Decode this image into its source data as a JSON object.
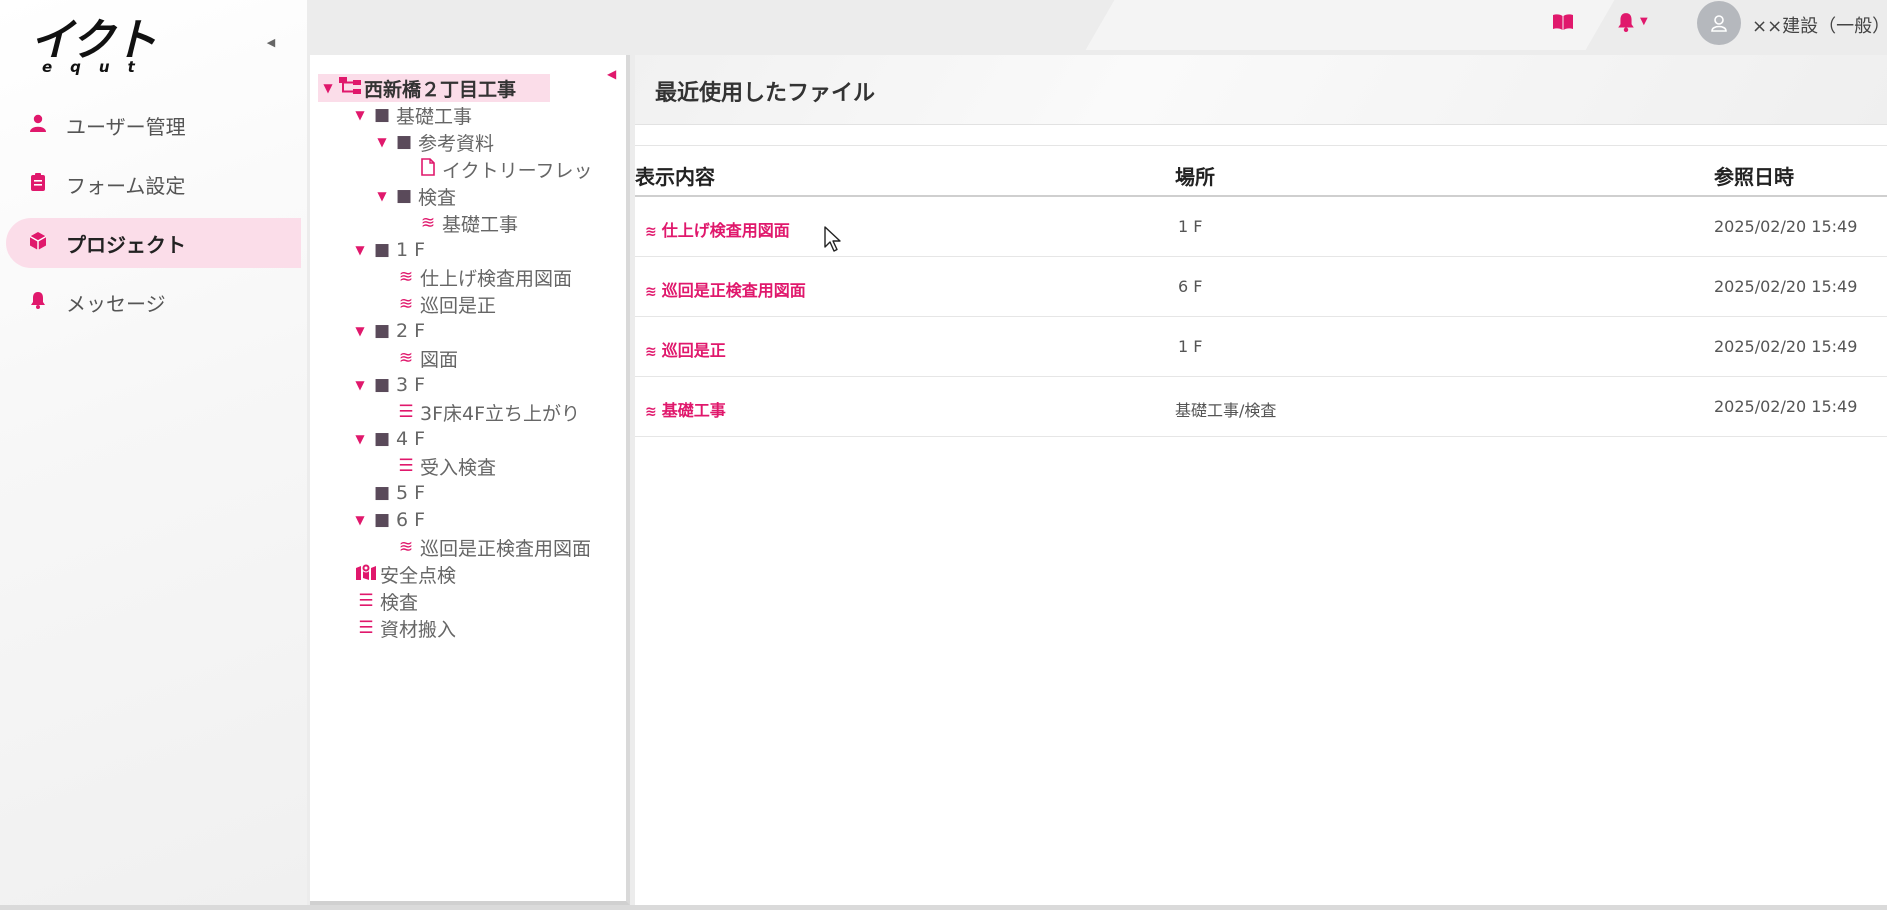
{
  "sidebar": {
    "logo_main": "イクト",
    "logo_sub": "equt",
    "items": [
      {
        "label": "ユーザー管理",
        "icon": "user-icon",
        "active": false
      },
      {
        "label": "フォーム設定",
        "icon": "clipboard-icon",
        "active": false
      },
      {
        "label": "プロジェクト",
        "icon": "cube-icon",
        "active": true
      },
      {
        "label": "メッセージ",
        "icon": "bell-icon",
        "active": false
      }
    ]
  },
  "topbar": {
    "username": "××建設（一般）"
  },
  "tree": {
    "nodes": [
      {
        "label": "西新橋２丁目工事",
        "type": "root",
        "expanded": true
      },
      {
        "label": "基礎工事",
        "type": "folder",
        "expanded": true
      },
      {
        "label": "参考資料",
        "type": "folder",
        "expanded": true
      },
      {
        "label": "イクトリーフレッ",
        "type": "file"
      },
      {
        "label": "検査",
        "type": "folder",
        "expanded": true
      },
      {
        "label": "基礎工事",
        "type": "layers"
      },
      {
        "label": "1 F",
        "type": "folder",
        "expanded": true
      },
      {
        "label": "仕上げ検査用図面",
        "type": "layers"
      },
      {
        "label": "巡回是正",
        "type": "layers"
      },
      {
        "label": "2 F",
        "type": "folder",
        "expanded": true
      },
      {
        "label": "図面",
        "type": "layers"
      },
      {
        "label": "3 F",
        "type": "folder",
        "expanded": true
      },
      {
        "label": "3F床4F立ち上がり",
        "type": "list"
      },
      {
        "label": "4 F",
        "type": "folder",
        "expanded": true
      },
      {
        "label": "受入検査",
        "type": "list"
      },
      {
        "label": "5 F",
        "type": "folder",
        "expanded": false
      },
      {
        "label": "6 F",
        "type": "folder",
        "expanded": true
      },
      {
        "label": "巡回是正検査用図面",
        "type": "layers"
      },
      {
        "label": "安全点検",
        "type": "map"
      },
      {
        "label": "検査",
        "type": "list"
      },
      {
        "label": "資材搬入",
        "type": "list"
      }
    ]
  },
  "main": {
    "title": "最近使用したファイル",
    "columns": [
      "表示内容",
      "場所",
      "参照日時"
    ],
    "rows": [
      {
        "name": "仕上げ検査用図面",
        "place": "1 F",
        "date": "2025/02/20 15:49"
      },
      {
        "name": "巡回是正検査用図面",
        "place": "6 F",
        "date": "2025/02/20 15:49"
      },
      {
        "name": "巡回是正",
        "place": "1 F",
        "date": "2025/02/20 15:49"
      },
      {
        "name": "基礎工事",
        "place": "基礎工事/検査",
        "date": "2025/02/20 15:49"
      }
    ]
  },
  "colors": {
    "accent": "#e0186c",
    "active_bg": "#fbdde9"
  }
}
